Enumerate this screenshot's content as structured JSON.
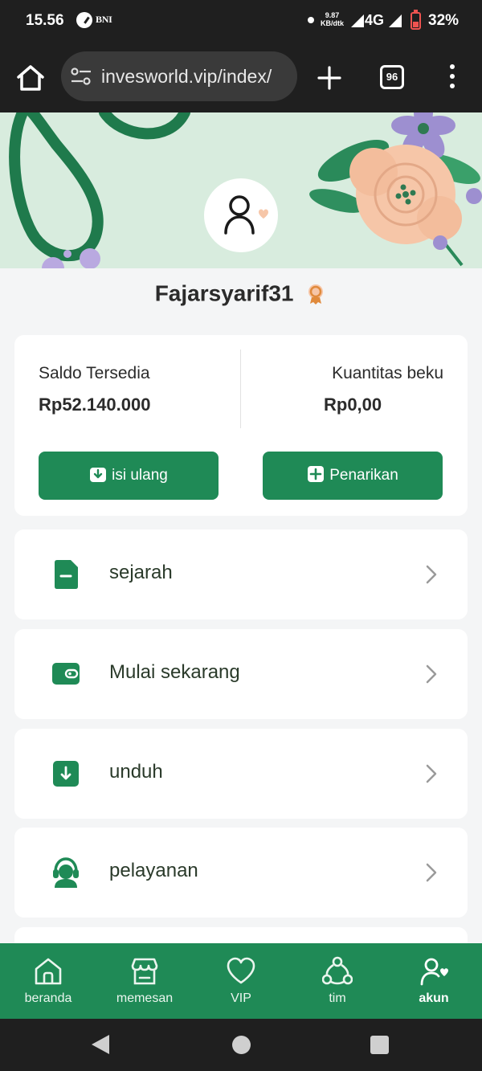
{
  "status_bar": {
    "time": "15.56",
    "carrier": "BNI",
    "net_speed_value": "9.87",
    "net_speed_unit": "KB/dtk",
    "network": "4G",
    "battery": "32%"
  },
  "browser": {
    "url": "invesworld.vip/index/",
    "tab_count": "96"
  },
  "profile": {
    "username": "Fajarsyarif31"
  },
  "balance": {
    "available_label": "Saldo Tersedia",
    "available_value": "Rp52.140.000",
    "frozen_label": "Kuantitas beku",
    "frozen_value": "Rp0,00",
    "topup_label": "isi ulang",
    "withdraw_label": "Penarikan"
  },
  "menu": [
    {
      "label": "sejarah",
      "icon": "document-icon"
    },
    {
      "label": "Mulai sekarang",
      "icon": "wallet-icon"
    },
    {
      "label": "unduh",
      "icon": "download-icon"
    },
    {
      "label": "pelayanan",
      "icon": "customer-service-icon"
    }
  ],
  "bottom_nav": [
    {
      "label": "beranda",
      "icon": "home-icon"
    },
    {
      "label": "memesan",
      "icon": "store-icon"
    },
    {
      "label": "VIP",
      "icon": "heart-icon"
    },
    {
      "label": "tim",
      "icon": "team-icon"
    },
    {
      "label": "akun",
      "icon": "account-icon",
      "active": true
    }
  ],
  "colors": {
    "primary": "#1f8a56",
    "banner_bg": "#d8ecde",
    "page_bg": "#f4f5f6"
  }
}
